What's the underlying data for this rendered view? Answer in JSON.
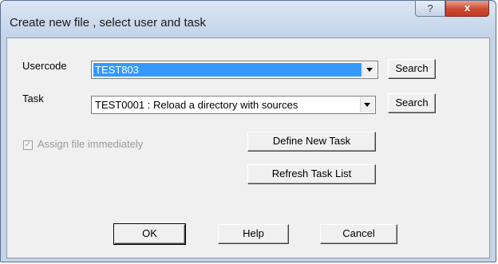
{
  "dialog": {
    "title": "Create new file , select user and task",
    "help_glyph": "?",
    "close_glyph": "x"
  },
  "usercode": {
    "label": "Usercode",
    "value": "TEST803",
    "search_label": "Search"
  },
  "task": {
    "label": "Task",
    "value": "TEST0001 : Reload a directory with sources",
    "search_label": "Search"
  },
  "assign": {
    "label": "Assign file immediately",
    "checked": true,
    "enabled": false
  },
  "actions": {
    "define_new_task": "Define New Task",
    "refresh_task_list": "Refresh Task List"
  },
  "footer": {
    "ok": "OK",
    "help": "Help",
    "cancel": "Cancel"
  },
  "icons": {
    "check_glyph": "✓"
  },
  "colors": {
    "selection": "#3399ff",
    "close_button": "#c7432a",
    "titlebar": "#c9d8ec"
  }
}
